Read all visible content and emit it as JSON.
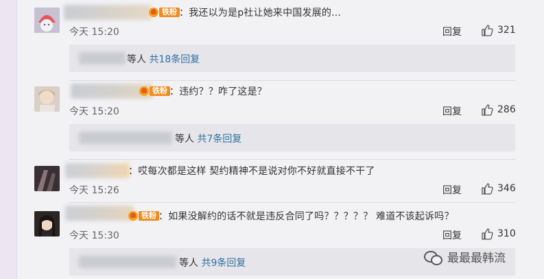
{
  "comments": [
    {
      "fan_tag": "铁粉",
      "text": "：我还以为是p社让她来中国发展的...",
      "time": "今天 15:20",
      "reply_label": "回复",
      "likes": "321",
      "sub_label": "等人",
      "sub_count": "共18条回复"
    },
    {
      "fan_tag": "铁粉",
      "text": "：违约？？咋了这是？",
      "time": "今天 15:20",
      "reply_label": "回复",
      "likes": "286",
      "sub_label": "等人",
      "sub_count": "共7条回复"
    },
    {
      "fan_tag": "",
      "text": "：哎每次都是这样 契约精神不是说对你不好就直接不干了",
      "time": "今天 15:26",
      "reply_label": "回复",
      "likes": "346"
    },
    {
      "fan_tag": "铁粉",
      "text": "：如果没解约的话不就是违反合同了吗？？？？？ 难道不该起诉吗？",
      "time": "今天 15:30",
      "reply_label": "回复",
      "likes": "310",
      "sub_label": "等人",
      "sub_count": "共9条回复"
    }
  ],
  "watermark": {
    "text": "最最最韩流",
    "icon": "wechat-icon"
  },
  "colors": {
    "background": "#ede6f2",
    "panel": "#f2f2f5",
    "sub_reply_box": "#e6e6ea",
    "reply_count_link": "#2e6fa0",
    "fan_tag": "#f08c1e"
  }
}
